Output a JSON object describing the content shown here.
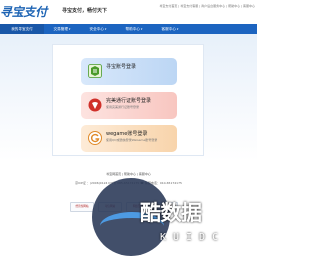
{
  "header": {
    "logo_text": "寻宝支付",
    "slogan": "寻宝支付，畅付天下",
    "top_links": "寻宝支付首页 | 寻宝支付客服 | 商户后台服务中心 | 帮助中心 | 客服中心"
  },
  "nav": {
    "items": [
      {
        "label": "我的寻宝支付",
        "arrow": ""
      },
      {
        "label": "交易管理",
        "arrow": "▾"
      },
      {
        "label": "安全中心",
        "arrow": "▾"
      },
      {
        "label": "帮助中心",
        "arrow": "▾"
      },
      {
        "label": "客服中心",
        "arrow": "▾"
      }
    ]
  },
  "login": {
    "options": [
      {
        "title": "寻宝账号登录",
        "desc": "",
        "icon": "xunbao-icon",
        "color": "#4a9a2a"
      },
      {
        "title": "完美通行证账号登录",
        "desc": "使用完美通行证账号登录",
        "icon": "perfect-world-icon",
        "color": "#d0302a"
      },
      {
        "title": "wegame账号登录",
        "desc": "使用QQ或微信登录WeGame账号登录",
        "icon": "wegame-icon",
        "color": "#e08a2a"
      }
    ]
  },
  "footer": {
    "links": "寻宝网首页 | 帮助中心 | 客服中心",
    "info": "京ICP证 ：(2006)0124 ICP号 085-65174175 ☎ 客服电话：010-65174175",
    "badges": [
      "经营性网站",
      "可信网站",
      "网络警察",
      "安全认证"
    ]
  },
  "watermark": {
    "text": "酷数据",
    "sub": "KUIDC"
  }
}
